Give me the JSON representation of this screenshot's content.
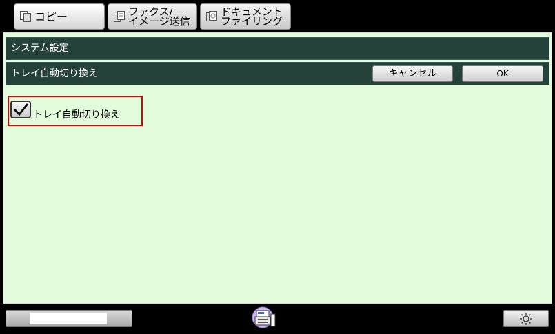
{
  "tabs": {
    "copy": "コピー",
    "fax": "ファクス/\nイメージ送信",
    "doc": "ドキュメント\nファイリング"
  },
  "header": {
    "section_title": "システム設定",
    "setting_title": "トレイ自動切り換え",
    "cancel_label": "キャンセル",
    "ok_label": "OK"
  },
  "option": {
    "label": "トレイ自動切り換え",
    "checked": true
  },
  "icons": {
    "copy": "copy-icon",
    "fax": "fax-send-icon",
    "doc": "document-filing-icon",
    "status": "printer-status-icon",
    "brightness": "brightness-icon"
  },
  "colors": {
    "panel_bg": "#e2fbdb",
    "bar_bg": "#25423a",
    "highlight": "#e00000"
  }
}
